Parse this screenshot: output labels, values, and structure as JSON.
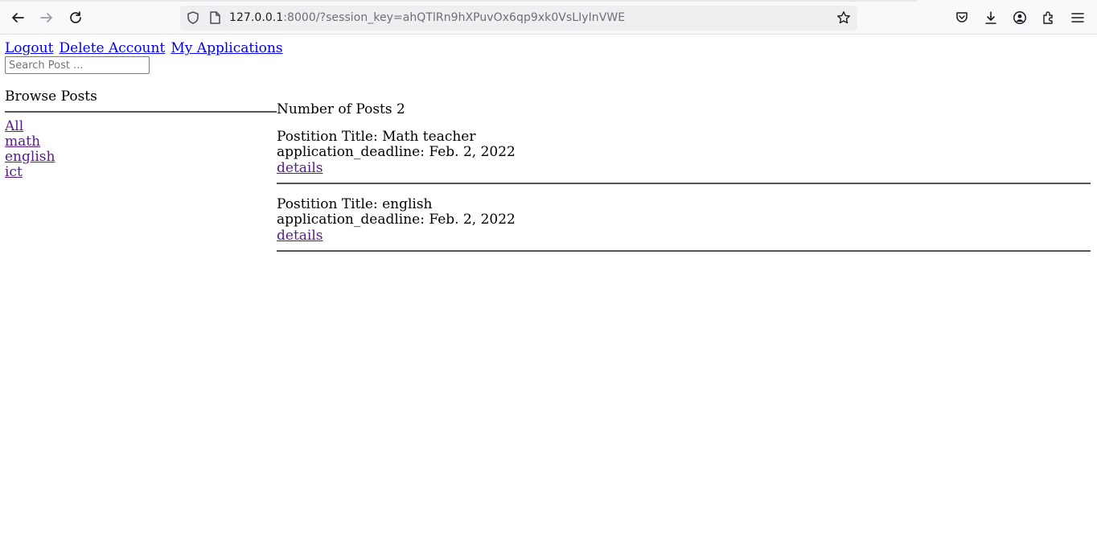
{
  "browser": {
    "url_host": "127.0.0.1",
    "url_rest": ":8000/?session_key=ahQTlRn9hXPuvOx6qp9xk0VsLIyInVWE",
    "icons": [
      "back-icon",
      "forward-icon",
      "reload-icon",
      "shield-icon",
      "page-icon",
      "star-icon",
      "pocket-icon",
      "download-icon",
      "account-icon",
      "extensions-icon",
      "menu-icon"
    ]
  },
  "nav": {
    "logout": "Logout",
    "delete_account": "Delete Account",
    "my_applications": "My Applications"
  },
  "search": {
    "placeholder": "Search Post ..."
  },
  "sidebar": {
    "title": "Browse Posts",
    "categories": [
      "All",
      "math",
      "english",
      "ict"
    ]
  },
  "main": {
    "count_text": "Number of Posts 2",
    "posts": [
      {
        "title": "Postition Title: Math teacher",
        "deadline": "application_deadline: Feb. 2, 2022",
        "link": "details"
      },
      {
        "title": "Postition Title: english",
        "deadline": "application_deadline: Feb. 2, 2022",
        "link": "details"
      }
    ]
  },
  "colors": {
    "link": "#0000ee",
    "visited": "#551a8b",
    "toolbar_bg": "#f9f9fb"
  }
}
